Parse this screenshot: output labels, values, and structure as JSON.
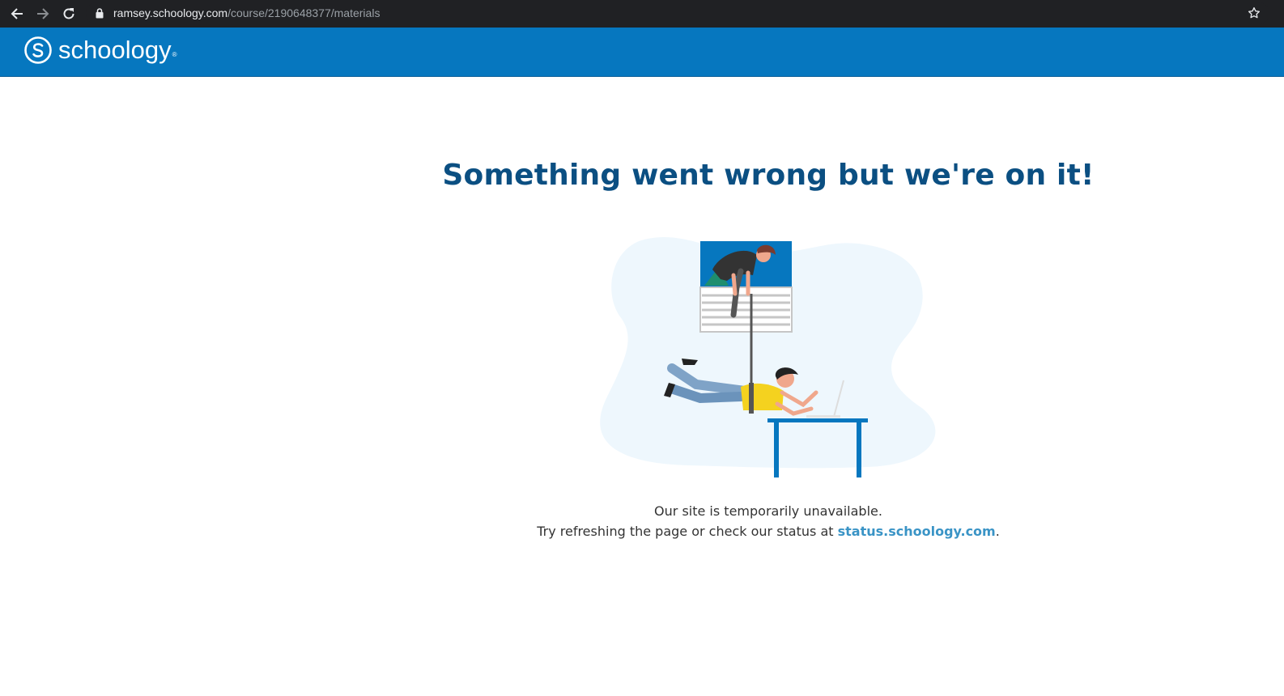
{
  "browser": {
    "url_host": "ramsey.schoology.com",
    "url_path": "/course/2190648377/materials",
    "icons": [
      "back-arrow-icon",
      "forward-arrow-icon",
      "reload-icon",
      "lock-icon",
      "star-icon"
    ]
  },
  "header": {
    "logo_text": "schoology",
    "logo_mark": "®",
    "brand_color": "#0677bf"
  },
  "error": {
    "headline": "Something went wrong but we're on it!",
    "line1": "Our site is temporarily unavailable.",
    "line2_prefix": "Try refreshing the page or check our status at ",
    "status_link": "status.schoology.com",
    "line2_suffix": ".",
    "headline_color": "#0b4f82",
    "link_color": "#3a94c6"
  }
}
